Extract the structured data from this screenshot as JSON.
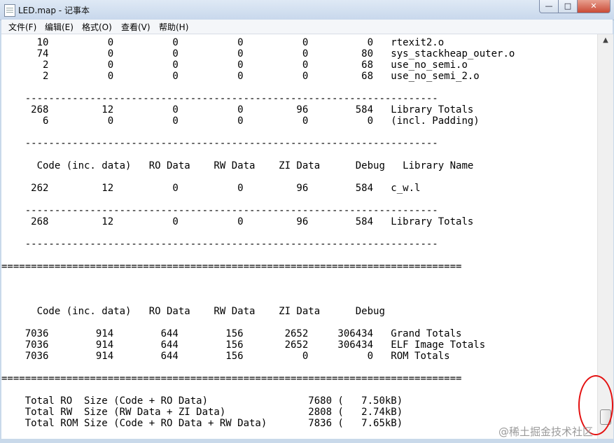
{
  "window": {
    "title": "LED.map - 记事本",
    "minimize_glyph": "—",
    "maximize_glyph": "□",
    "close_glyph": "✕"
  },
  "menu": [
    "文件(F)",
    "编辑(E)",
    "格式(O)",
    "查看(V)",
    "帮助(H)"
  ],
  "content": {
    "lines": [
      "      10          0          0          0          0          0   rtexit2.o",
      "      74          0          0          0          0         80   sys_stackheap_outer.o",
      "       2          0          0          0          0         68   use_no_semi.o",
      "       2          0          0          0          0         68   use_no_semi_2.o",
      "",
      "    ----------------------------------------------------------------------",
      "     268         12          0          0         96        584   Library Totals",
      "       6          0          0          0          0          0   (incl. Padding)",
      "",
      "    ----------------------------------------------------------------------",
      "",
      "      Code (inc. data)   RO Data    RW Data    ZI Data      Debug   Library Name",
      "",
      "     262         12          0          0         96        584   c_w.l",
      "",
      "    ----------------------------------------------------------------------",
      "     268         12          0          0         96        584   Library Totals",
      "",
      "    ----------------------------------------------------------------------",
      "",
      "==============================================================================",
      "",
      "",
      "",
      "      Code (inc. data)   RO Data    RW Data    ZI Data      Debug",
      "",
      "    7036        914        644        156       2652     306434   Grand Totals",
      "    7036        914        644        156       2652     306434   ELF Image Totals",
      "    7036        914        644        156          0          0   ROM Totals",
      "",
      "==============================================================================",
      "",
      "    Total RO  Size (Code + RO Data)                 7680 (   7.50kB)",
      "    Total RW  Size (RW Data + ZI Data)              2808 (   2.74kB)",
      "    Total ROM Size (Code + RO Data + RW Data)       7836 (   7.65kB)"
    ]
  },
  "scrollbar": {
    "up_glyph": "▲"
  },
  "watermark": "@稀土掘金技术社区"
}
